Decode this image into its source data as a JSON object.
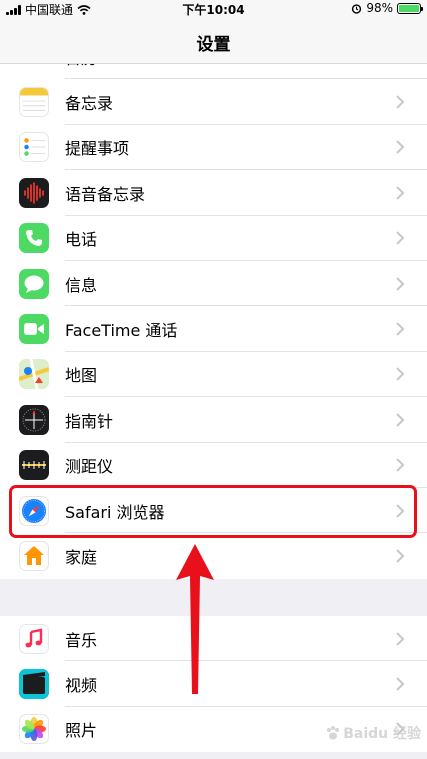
{
  "status_bar": {
    "carrier": "中国联通",
    "time": "下午10:04",
    "battery": "98%",
    "battery_level": 0.98
  },
  "nav": {
    "title": "设置"
  },
  "group1": {
    "partial_label": "日历",
    "items": [
      {
        "label": "备忘录",
        "icon": "notes-icon"
      },
      {
        "label": "提醒事项",
        "icon": "reminders-icon"
      },
      {
        "label": "语音备忘录",
        "icon": "voice-memos-icon"
      },
      {
        "label": "电话",
        "icon": "phone-icon"
      },
      {
        "label": "信息",
        "icon": "messages-icon"
      },
      {
        "label": "FaceTime 通话",
        "icon": "facetime-icon"
      },
      {
        "label": "地图",
        "icon": "maps-icon"
      },
      {
        "label": "指南针",
        "icon": "compass-icon"
      },
      {
        "label": "测距仪",
        "icon": "measure-icon"
      },
      {
        "label": "Safari 浏览器",
        "icon": "safari-icon"
      },
      {
        "label": "家庭",
        "icon": "home-icon"
      }
    ]
  },
  "group2": {
    "items": [
      {
        "label": "音乐",
        "icon": "music-icon"
      },
      {
        "label": "视频",
        "icon": "videos-icon"
      },
      {
        "label": "照片",
        "icon": "photos-icon"
      }
    ]
  },
  "watermark": {
    "text": "Baidu 经验"
  },
  "colors": {
    "highlight": "#e8101a",
    "green": "#4cd964",
    "blue": "#1a82fb"
  }
}
